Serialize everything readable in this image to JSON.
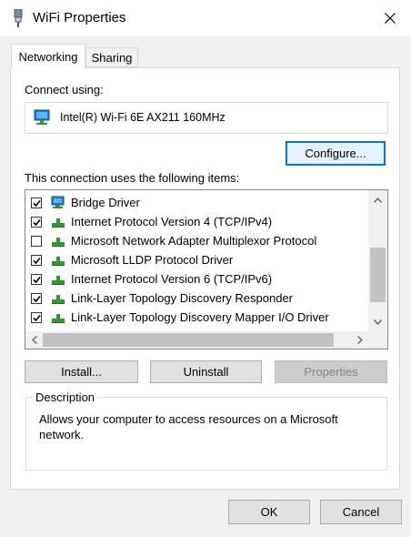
{
  "window": {
    "title": "WiFi Properties",
    "close_icon": "close-icon"
  },
  "tabs": [
    {
      "label": "Networking",
      "active": true
    },
    {
      "label": "Sharing",
      "active": false
    }
  ],
  "networking": {
    "connect_using_label": "Connect using:",
    "adapter_name": "Intel(R) Wi-Fi 6E AX211 160MHz",
    "configure_label": "Configure...",
    "items_label": "This connection uses the following items:",
    "items": [
      {
        "label": "Bridge Driver",
        "checked": true,
        "icon": "network-adapter-icon"
      },
      {
        "label": "Internet Protocol Version 4 (TCP/IPv4)",
        "checked": true,
        "icon": "protocol-icon"
      },
      {
        "label": "Microsoft Network Adapter Multiplexor Protocol",
        "checked": false,
        "icon": "protocol-icon"
      },
      {
        "label": "Microsoft LLDP Protocol Driver",
        "checked": true,
        "icon": "protocol-icon"
      },
      {
        "label": "Internet Protocol Version 6 (TCP/IPv6)",
        "checked": true,
        "icon": "protocol-icon"
      },
      {
        "label": "Link-Layer Topology Discovery Responder",
        "checked": true,
        "icon": "protocol-icon"
      },
      {
        "label": "Link-Layer Topology Discovery Mapper I/O Driver",
        "checked": true,
        "icon": "protocol-icon"
      }
    ],
    "install_label": "Install...",
    "uninstall_label": "Uninstall",
    "properties_label": "Properties",
    "description_title": "Description",
    "description_text": "Allows your computer to access resources on a Microsoft network."
  },
  "footer": {
    "ok_label": "OK",
    "cancel_label": "Cancel"
  },
  "colors": {
    "accent": "#0078d7",
    "protocol_icon": "#2e9a2e",
    "adapter_icon": "#1e7fd1"
  }
}
